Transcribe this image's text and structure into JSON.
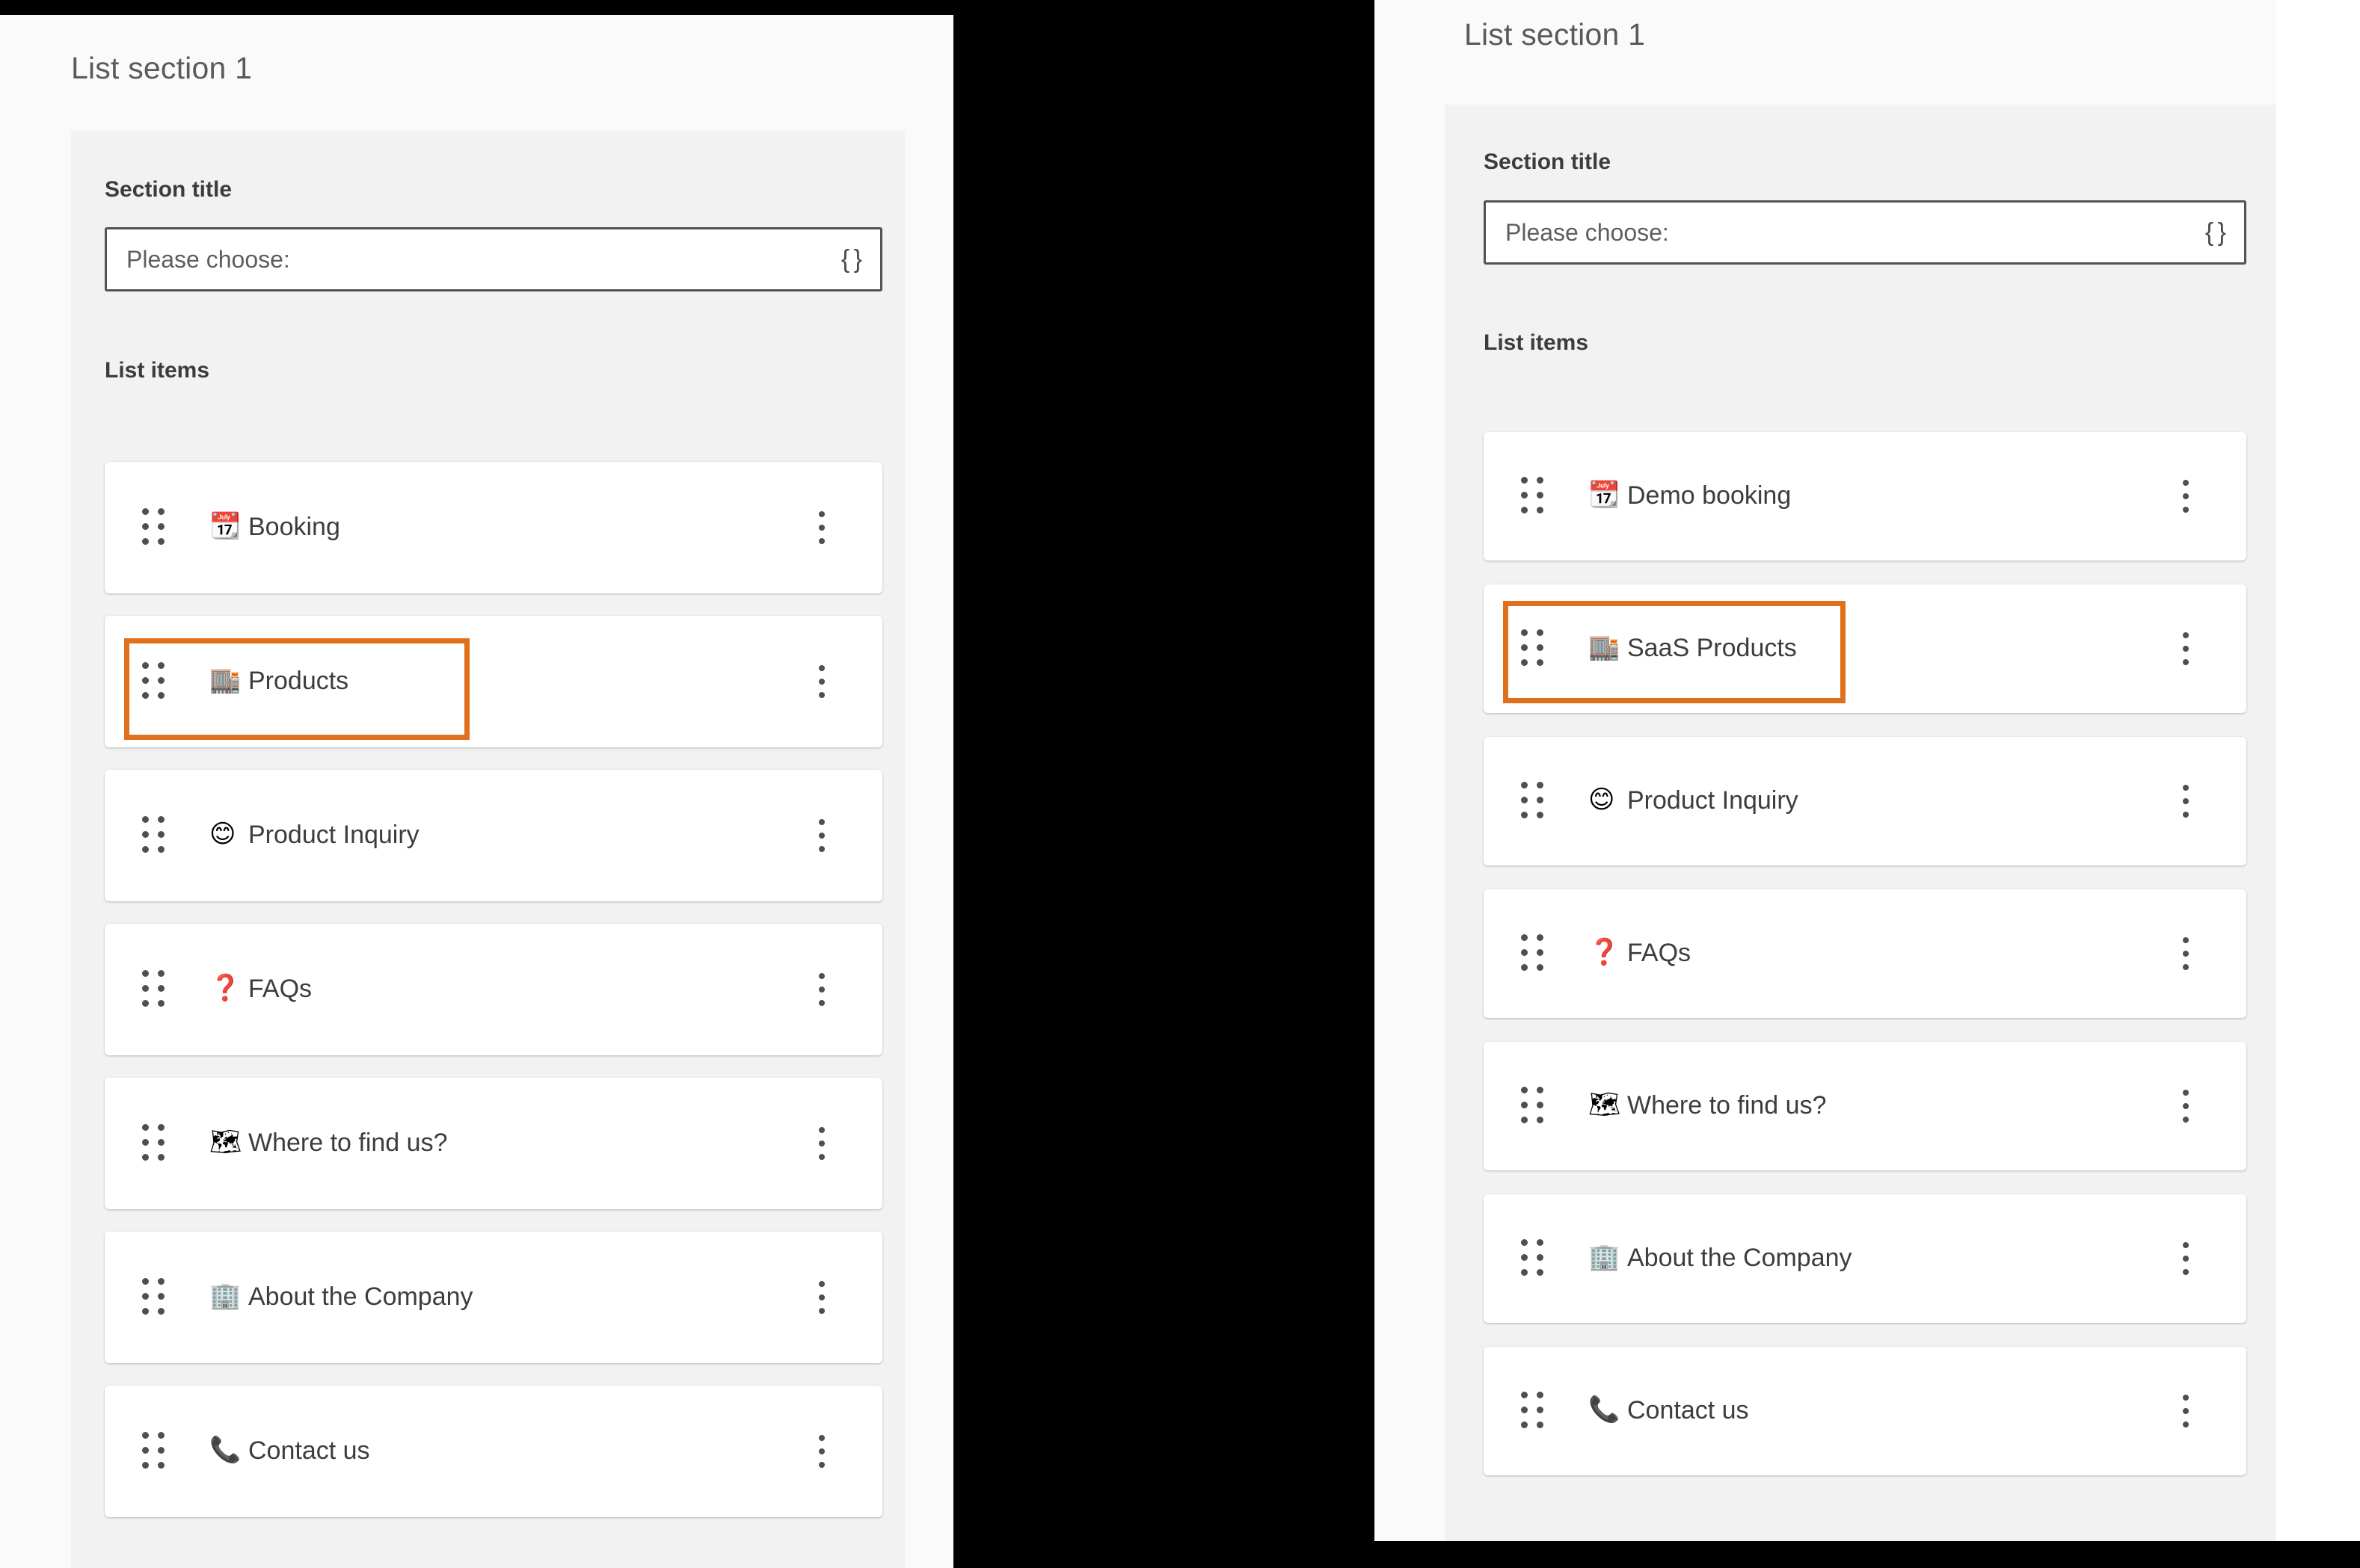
{
  "panels": [
    {
      "id": "left",
      "section_heading": "List section 1",
      "section_title_label": "Section title",
      "select_placeholder": "Please choose:",
      "select_icon": "curly-braces-icon",
      "select_icon_glyph": "{ }",
      "list_items_label": "List items",
      "highlighted_index": 1,
      "items": [
        {
          "emoji": "📆",
          "emoji_name": "tear-off-calendar-icon",
          "label": "Booking"
        },
        {
          "emoji": "🏬",
          "emoji_name": "department-store-icon",
          "label": "Products"
        },
        {
          "emoji": "😊",
          "emoji_name": "smiling-face-icon",
          "label": "Product Inquiry"
        },
        {
          "emoji": "❓",
          "emoji_name": "question-mark-icon",
          "label": "FAQs"
        },
        {
          "emoji": "🗺",
          "emoji_name": "world-map-icon",
          "label": "Where to find us?"
        },
        {
          "emoji": "🏢",
          "emoji_name": "office-building-icon",
          "label": "About the Company"
        },
        {
          "emoji": "📞",
          "emoji_name": "telephone-receiver-icon",
          "label": "Contact us"
        }
      ]
    },
    {
      "id": "right",
      "section_heading": "List section 1",
      "section_title_label": "Section title",
      "select_placeholder": "Please choose:",
      "select_icon": "curly-braces-icon",
      "select_icon_glyph": "{ }",
      "list_items_label": "List items",
      "highlighted_index": 1,
      "items": [
        {
          "emoji": "📆",
          "emoji_name": "tear-off-calendar-icon",
          "label": "Demo booking"
        },
        {
          "emoji": "🏬",
          "emoji_name": "department-store-icon",
          "label": "SaaS Products"
        },
        {
          "emoji": "😊",
          "emoji_name": "smiling-face-icon",
          "label": "Product Inquiry"
        },
        {
          "emoji": "❓",
          "emoji_name": "question-mark-icon",
          "label": "FAQs"
        },
        {
          "emoji": "🗺",
          "emoji_name": "world-map-icon",
          "label": "Where to find us?"
        },
        {
          "emoji": "🏢",
          "emoji_name": "office-building-icon",
          "label": "About the Company"
        },
        {
          "emoji": "📞",
          "emoji_name": "telephone-receiver-icon",
          "label": "Contact us"
        }
      ]
    }
  ],
  "colors": {
    "highlight": "#E0701C",
    "page_background": "#000000",
    "panel_background": "#fafafa",
    "card_background": "#f2f2f2",
    "row_background": "#ffffff",
    "heading_text": "#5a5a5a",
    "label_text": "#3c3c3c",
    "row_text": "#3d3d3d"
  }
}
